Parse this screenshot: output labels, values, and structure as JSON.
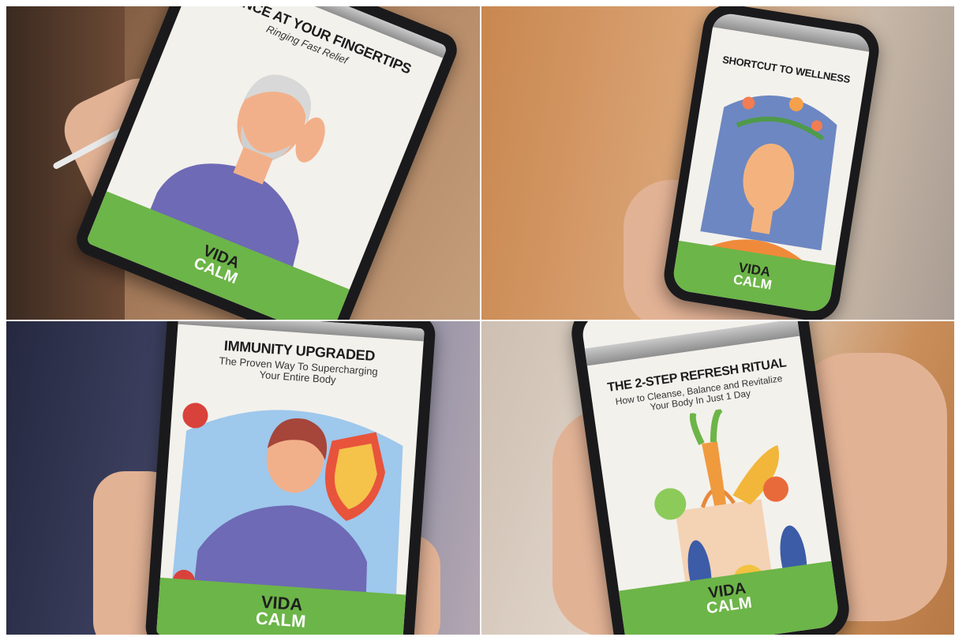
{
  "mockups": [
    {
      "title": "SILENCE AT YOUR FINGERTIPS",
      "subtitle": "Ringing Fast Relief",
      "brand_line1": "VIDA",
      "brand_line2": "CALM"
    },
    {
      "title": "SHORTCUT TO WELLNESS",
      "subtitle": "",
      "brand_line1": "VIDA",
      "brand_line2": "CALM"
    },
    {
      "title": "IMMUNITY UPGRADED",
      "subtitle": "The Proven Way To Supercharging Your Entire Body",
      "brand_line1": "VIDA",
      "brand_line2": "CALM"
    },
    {
      "title": "THE 2-STEP REFRESH RITUAL",
      "subtitle": "How to Cleanse, Balance and Revitalize Your Body In Just 1 Day",
      "brand_line1": "VIDA",
      "brand_line2": "CALM"
    }
  ],
  "colors": {
    "brand_green": "#6cb548",
    "illustration_purple": "#6e6ab5",
    "screen_bg": "#f3f1ec"
  }
}
